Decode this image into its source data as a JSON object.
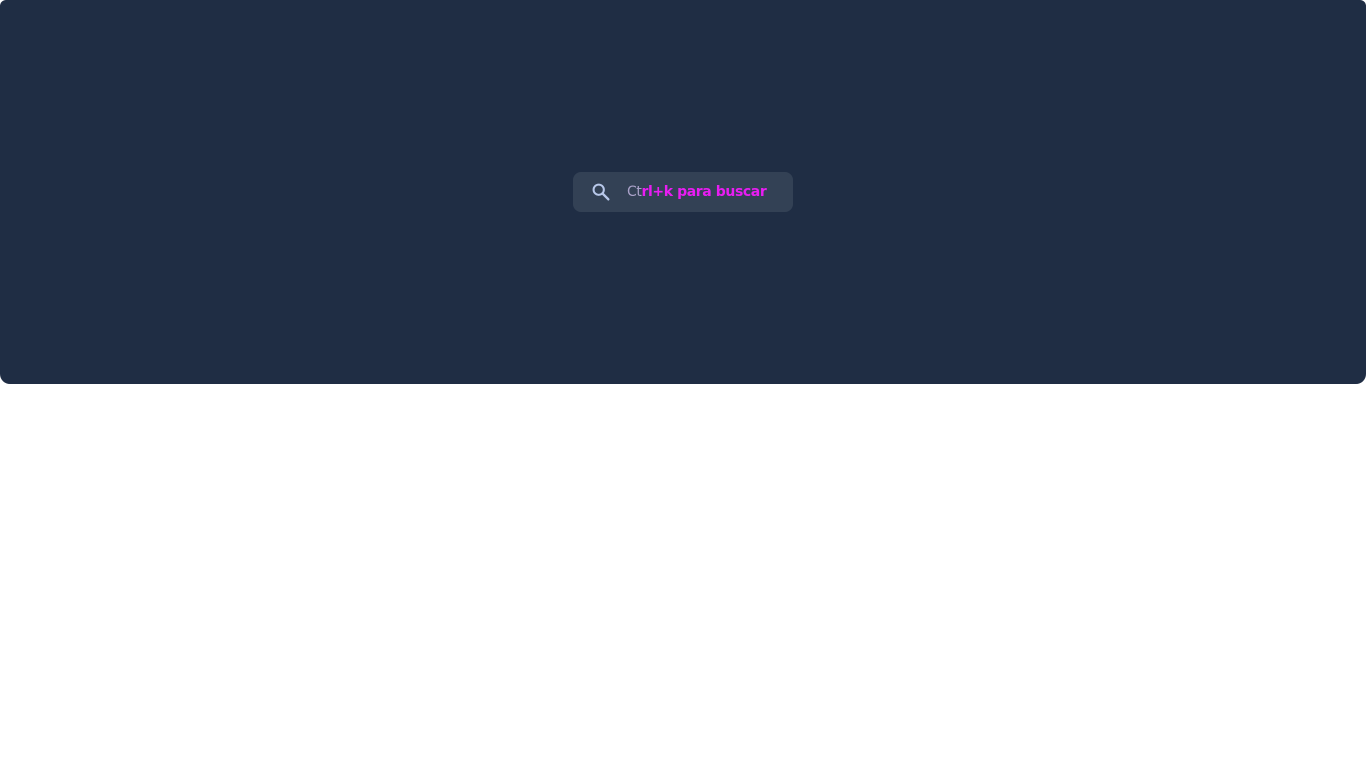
{
  "hero": {
    "background_color": "#1f2d44"
  },
  "search": {
    "icon": "search-icon",
    "placeholder_muted": "Ct",
    "placeholder_accent": "rl+k para buscar",
    "box_color": "#334155",
    "icon_color": "#b8c8ea",
    "muted_color": "#a9a1c8",
    "accent_color": "#e81df2"
  }
}
